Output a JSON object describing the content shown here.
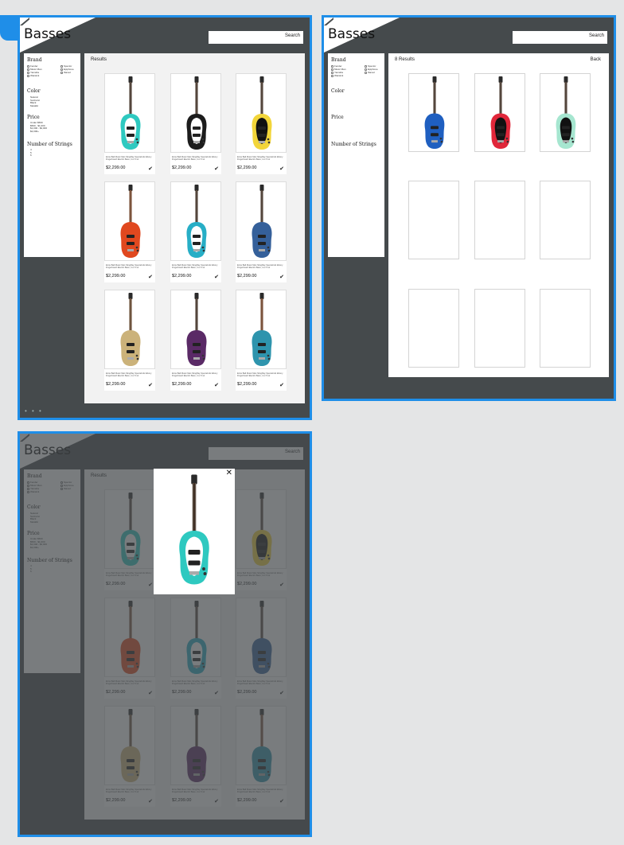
{
  "page_title": "Basses",
  "search_label": "Search",
  "filters": {
    "brand_heading": "Brand",
    "color_heading": "Color",
    "price_heading": "Price",
    "strings_heading": "Number of Strings",
    "brand_options": [
      "Fender",
      "Music Man",
      "Yamaha",
      "Warwick",
      "Spector",
      "Epiphone",
      "Ibanez"
    ],
    "color_options": [
      "Natural",
      "Sunburst",
      "Black",
      "Metallic"
    ],
    "price_options": [
      "Under $500",
      "$500 - $1,000",
      "$1,000 - $2,000",
      "$2,000+"
    ],
    "string_options": [
      "4",
      "5",
      "6"
    ]
  },
  "results_label": "Results",
  "filtered_results_label": "8 Results",
  "back_label": "Back",
  "product_description": "Ernie Ball Music Man StingRay Special HH Ebony Fingerboard Electric Bass, 4 or 5 str",
  "products": [
    {
      "price": "$2,299.00",
      "body_color": "#2ec9c0",
      "guard": "white",
      "neck": "#3b2a1e"
    },
    {
      "price": "$2,299.00",
      "body_color": "#1c1c1c",
      "guard": "white",
      "neck": "#3b2a1e"
    },
    {
      "price": "$2,299.00",
      "body_color": "#f2d53a",
      "guard": "black",
      "neck": "#3b2a1e"
    },
    {
      "price": "$2,299.00",
      "body_color": "#e0481f",
      "guard": "none",
      "neck": "#6b3a1e"
    },
    {
      "price": "$2,299.00",
      "body_color": "#27aec6",
      "guard": "white",
      "neck": "#3b2a1e"
    },
    {
      "price": "$2,299.00",
      "body_color": "#35609a",
      "guard": "none",
      "neck": "#3b2a1e"
    },
    {
      "price": "$2,299.00",
      "body_color": "#cbb27a",
      "guard": "none",
      "neck": "#5a3a20"
    },
    {
      "price": "$2,299.00",
      "body_color": "#5a2a66",
      "guard": "none",
      "neck": "#3b2a1e"
    },
    {
      "price": "$2,299.00",
      "body_color": "#2e94ad",
      "guard": "none",
      "neck": "#6b3a1e"
    }
  ],
  "filtered_products": [
    {
      "body_color": "#1f5fc0",
      "guard": "none"
    },
    {
      "body_color": "#e0273a",
      "guard": "black"
    },
    {
      "body_color": "#a6e6d0",
      "guard": "black"
    }
  ],
  "accent_color": "#1f8ee8",
  "board_color": "#454a4c",
  "close_icon": "close-icon"
}
